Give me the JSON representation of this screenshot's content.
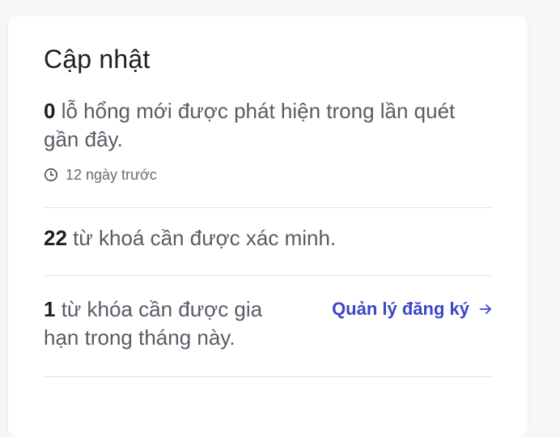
{
  "card": {
    "title": "Cập nhật"
  },
  "vulnerabilities": {
    "count": "0",
    "text": " lỗ hổng mới được phát hiện trong lần quét gần đây.",
    "time_ago": "12 ngày trước",
    "time_icon": "clock-icon"
  },
  "keywords_verify": {
    "count": "22",
    "text": " từ khoá cần được xác minh."
  },
  "keywords_renew": {
    "count": "1",
    "text": " từ khóa cần được gia hạn trong tháng này.",
    "link_label": "Quản lý đăng ký",
    "link_icon": "arrow-right-icon"
  },
  "colors": {
    "link": "#3b46c8",
    "text_primary": "#1d1d24",
    "text_secondary": "#5a5a66",
    "divider": "#e4e4e8"
  }
}
